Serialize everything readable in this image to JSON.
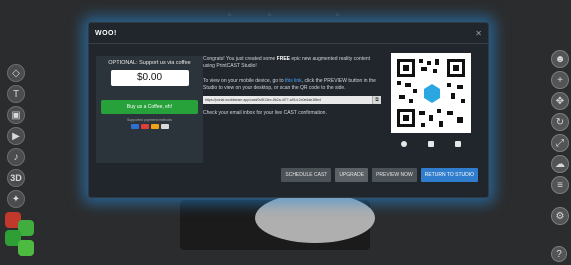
{
  "modal": {
    "title": "WOO!",
    "close_icon": "close-icon",
    "support": {
      "title": "OPTIONAL: Support us via coffee",
      "amount": "$0.00",
      "button": "Buy us a Coffee, eh!",
      "payments_label": "Supported payment methods",
      "payment_icons": [
        "card-icon",
        "card-icon",
        "card-icon",
        "card-icon"
      ]
    },
    "message": {
      "pre_free": "Congrats! You just created some",
      "free": "FREE",
      "post_free": "epic new augmented reality content using PrintCAST Studio!",
      "view_pre": "To view on your mobile device, go to",
      "view_link": "this link",
      "view_post": ", click the PREVIEW button in the Studio to view on your desktop, or scan the QR code to the side.",
      "url": "https://portal.worldbeam.app/cast/0c5f13ec-8b2a-4f77-a91d-2c0e6ab1f8e4",
      "check_inbox": "Check your email inbox for your live CAST confirmation."
    },
    "buttons": {
      "schedule": "SCHEDULE CAST",
      "upgrade": "UPGRADE",
      "preview": "PREVIEW NOW",
      "return": "RETURN TO STUDIO"
    }
  },
  "colors": {
    "modal_glow": "#2a8fe0",
    "coffee_green": "#27a23a",
    "primary_blue": "#2f7dcc"
  }
}
